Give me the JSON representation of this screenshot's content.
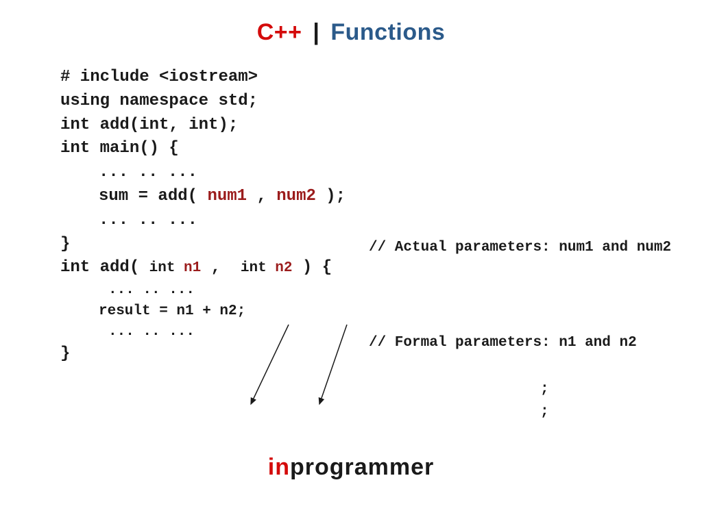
{
  "header": {
    "cpp": "C++",
    "pipe": "|",
    "functions": "Functions"
  },
  "code": {
    "l1": "# include <iostream>",
    "l2": "using namespace std;",
    "l3": "",
    "l4": "int add(int, int);",
    "l5": "",
    "l6": "int main() {",
    "l7_dots": "... .. ...",
    "l8_pre": "sum = add( ",
    "l8_num1": "num1",
    "l8_comma": " , ",
    "l8_num2": "num2",
    "l8_post": " );",
    "l8_comment_pre": "// Actual parameters: ",
    "l8_comment_n1": "num1",
    "l8_comment_and": " and ",
    "l8_comment_n2": "num2",
    "l9_dots": "... .. ...",
    "l10": "}",
    "l11": "",
    "l12_pre": "int add( ",
    "l12_int1": "int ",
    "l12_n1": "n1",
    "l12_mid": " ,  ",
    "l12_int2": "int ",
    "l12_n2": "n2",
    "l12_post": " ) {",
    "l12_comment_pre": "// Formal parameters: ",
    "l12_comment_n1": "n1",
    "l12_comment_and": " and ",
    "l12_comment_n2": "n2",
    "l13_dots": "... .. ...",
    "l14": "result = n1 + n2;",
    "l15_dots": "... .. ...",
    "l16": "}",
    "semi1": ";",
    "semi2": ";"
  },
  "footer": {
    "in": "in",
    "programmer": "programmer"
  }
}
